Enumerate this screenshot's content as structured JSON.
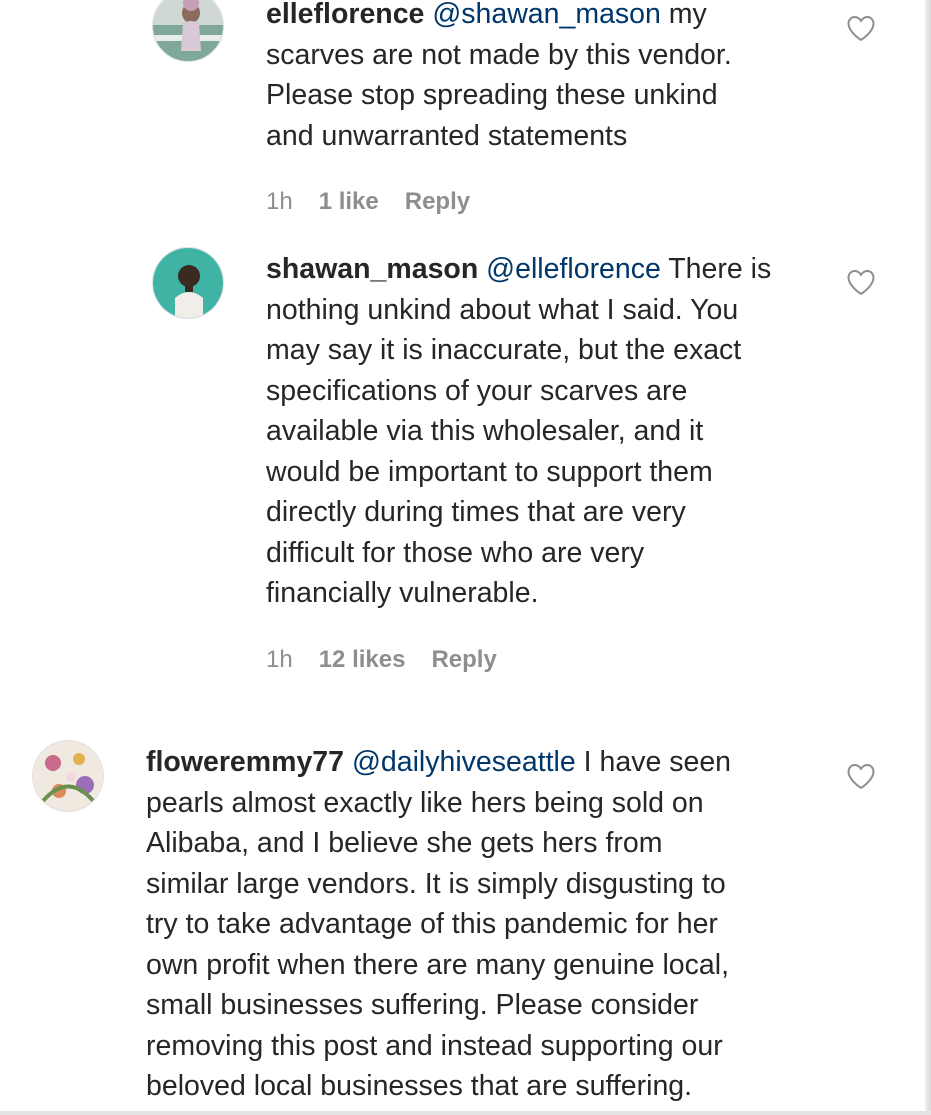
{
  "comments": [
    {
      "username": "elleflorence",
      "mention": "@shawan_mason",
      "body_first": " my",
      "lines": [
        "scarves are not made by this vendor.",
        "Please stop spreading these unkind",
        "and unwarranted statements"
      ],
      "time": "1h",
      "likes": "1 like",
      "reply": "Reply",
      "avatar_icon": "avatar-photo"
    },
    {
      "username": "shawan_mason",
      "mention": "@elleflorence",
      "body_first": " There is",
      "lines": [
        "nothing unkind about what I said. You",
        "may say it is inaccurate, but the exact",
        "specifications of your scarves are",
        "available via this wholesaler, and it",
        "would be important to support them",
        "directly during times that are very",
        "difficult for those who are very",
        "financially vulnerable."
      ],
      "time": "1h",
      "likes": "12 likes",
      "reply": "Reply",
      "avatar_icon": "avatar-photo"
    },
    {
      "username": "floweremmy77",
      "mention": "@dailyhiveseattle",
      "body_first": " I have seen",
      "lines": [
        "pearls almost exactly like hers being sold on",
        "Alibaba, and I believe she gets hers from",
        "similar large vendors. It is simply disgusting to",
        "try to take advantage of this pandemic for her",
        "own profit when there are many genuine local,",
        "small businesses suffering. Please consider",
        "removing this post and instead supporting our",
        "beloved local businesses that are suffering."
      ],
      "avatar_icon": "avatar-photo"
    }
  ],
  "icons": {
    "like": "heart-outline-icon"
  },
  "colors": {
    "text": "#262626",
    "mention": "#00376b",
    "meta": "#8e8e8e"
  }
}
